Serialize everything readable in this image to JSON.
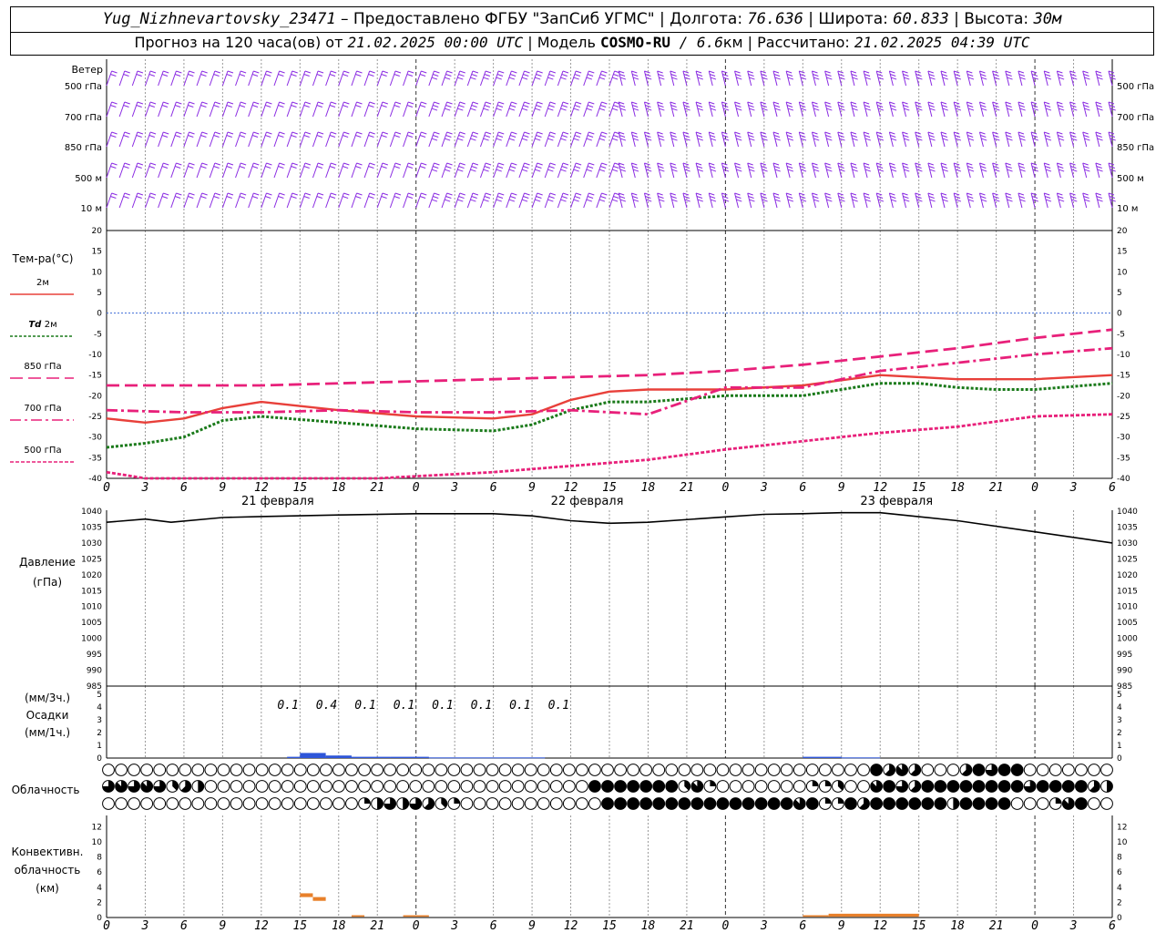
{
  "header": {
    "station": "Yug_Nizhnevartovsky_23471",
    "provider": " – Предоставлено ФГБУ \"ЗапСиб УГМС\" | ",
    "lon_label": "Долгота: ",
    "lon": "76.636",
    "lat_label": " | Широта: ",
    "lat": "60.833",
    "alt_label": " | Высота: ",
    "alt": "30м",
    "forecast_prefix": "Прогноз на 120 часа(ов) от ",
    "forecast_time": "21.02.2025 00:00 UTC",
    "model_label": " | Модель ",
    "model": "COSMO-RU",
    "resolution": " / 6.6",
    "resolution_unit": "км",
    "calc_label": " | Рассчитано: ",
    "calc_time": "21.02.2025 04:39 UTC"
  },
  "wind": {
    "title": "Ветер",
    "levels": [
      "500 гПа",
      "700 гПа",
      "850 гПа",
      "500 м",
      "10 м"
    ],
    "color": "#8a2be2"
  },
  "chart_data": [
    {
      "type": "line",
      "panel": "temperature",
      "ylabel": "Тем-ра(°C)",
      "ylim": [
        -40,
        20
      ],
      "yticks": [
        20,
        15,
        10,
        5,
        0,
        -5,
        -10,
        -15,
        -20,
        -25,
        -30,
        -35,
        -40
      ],
      "x_hours": [
        0,
        6,
        12,
        18,
        24,
        30,
        36,
        42,
        48,
        54,
        60,
        66,
        72,
        78
      ],
      "series": [
        {
          "name": "2м",
          "color": "#e8403a",
          "dash": "solid",
          "x": [
            0,
            3,
            6,
            9,
            12,
            18,
            24,
            30,
            33,
            36,
            39,
            42,
            48,
            54,
            60,
            63,
            66,
            69,
            72,
            78
          ],
          "values": [
            -25.5,
            -26.5,
            -25.5,
            -23,
            -21.5,
            -23.5,
            -25,
            -25.5,
            -24.5,
            -21,
            -19,
            -18.5,
            -18.5,
            -17.5,
            -15,
            -15.5,
            -16,
            -16,
            -16,
            -15
          ]
        },
        {
          "name": "Td 2м",
          "color": "#1a7a1a",
          "dash": "dotted",
          "x": [
            0,
            3,
            6,
            9,
            12,
            18,
            24,
            30,
            33,
            36,
            39,
            42,
            48,
            54,
            60,
            63,
            66,
            69,
            72,
            78
          ],
          "values": [
            -32.5,
            -31.5,
            -30,
            -26,
            -25,
            -26.5,
            -28,
            -28.5,
            -27,
            -23.5,
            -21.5,
            -21.5,
            -20,
            -20,
            -17,
            -17,
            -18,
            -18.5,
            -18.5,
            -17
          ]
        },
        {
          "name": "850 гПа",
          "color": "#e8207a",
          "dash": "longdash",
          "x": [
            0,
            6,
            12,
            18,
            24,
            30,
            36,
            42,
            48,
            54,
            60,
            66,
            72,
            78
          ],
          "values": [
            -17.5,
            -17.5,
            -17.5,
            -17,
            -16.5,
            -16,
            -15.5,
            -15,
            -14,
            -12.5,
            -10.5,
            -8.5,
            -6,
            -4
          ]
        },
        {
          "name": "700 гПа",
          "color": "#e8207a",
          "dash": "dashdot",
          "x": [
            0,
            6,
            12,
            18,
            24,
            30,
            36,
            42,
            48,
            54,
            60,
            66,
            72,
            78
          ],
          "values": [
            -23.5,
            -24,
            -24,
            -23.5,
            -24,
            -24,
            -23.5,
            -24.5,
            -18,
            -18,
            -14,
            -12,
            -10,
            -8.5
          ]
        },
        {
          "name": "500 гПа",
          "color": "#e8207a",
          "dash": "shortdash",
          "x": [
            0,
            3,
            6,
            9,
            12,
            18,
            21,
            24,
            30,
            36,
            42,
            48,
            54,
            60,
            66,
            72,
            78
          ],
          "values": [
            -38.5,
            -40,
            -41,
            -41,
            -41,
            -41,
            -40,
            -39.5,
            -38.5,
            -37,
            -35.5,
            -33,
            -31,
            -29,
            -27.5,
            -25,
            -24.5
          ]
        }
      ]
    },
    {
      "type": "line",
      "panel": "pressure",
      "ylabel": "Давление",
      "ylabel2": "(гПа)",
      "ylim": [
        985,
        1040
      ],
      "yticks": [
        1040,
        1035,
        1030,
        1025,
        1020,
        1015,
        1010,
        1005,
        1000,
        995,
        990,
        985
      ],
      "series": [
        {
          "color": "#000000",
          "dash": "solid",
          "x": [
            0,
            3,
            5,
            9,
            12,
            18,
            24,
            30,
            33,
            36,
            39,
            42,
            48,
            51,
            54,
            57,
            60,
            66,
            72,
            78
          ],
          "values": [
            1036.5,
            1037.5,
            1036.5,
            1038,
            1038.3,
            1038.8,
            1039.2,
            1039.2,
            1038.5,
            1037,
            1036.2,
            1036.5,
            1038.2,
            1039,
            1039.2,
            1039.5,
            1039.5,
            1037,
            1033.5,
            1030
          ]
        }
      ]
    },
    {
      "type": "bar",
      "panel": "precipitation",
      "ylabel1": "(мм/3ч.)",
      "ylabel2": "Осадки",
      "ylabel3": "(мм/1ч.)",
      "ylim": [
        0,
        5
      ],
      "yticks": [
        5,
        4,
        3,
        2,
        1,
        0
      ],
      "bars": [
        {
          "x": 14,
          "w": 1,
          "values": 0.1
        },
        {
          "x": 15,
          "w": 2,
          "values": 0.4
        },
        {
          "x": 17,
          "w": 2,
          "values": 0.2
        },
        {
          "x": 19,
          "w": 3,
          "values": 0.1
        },
        {
          "x": 22,
          "w": 3,
          "values": 0.1
        },
        {
          "x": 25,
          "w": 9,
          "values": 0.05
        },
        {
          "x": 54,
          "w": 3,
          "values": 0.1
        },
        {
          "x": 57,
          "w": 3,
          "values": 0.05
        }
      ],
      "labels": [
        {
          "x": 13.5,
          "text": "0.1"
        },
        {
          "x": 16.5,
          "text": "0.4"
        },
        {
          "x": 19.5,
          "text": "0.1"
        },
        {
          "x": 22.5,
          "text": "0.1"
        },
        {
          "x": 25.5,
          "text": "0.1"
        },
        {
          "x": 28.5,
          "text": "0.1"
        },
        {
          "x": 31.5,
          "text": "0.1"
        },
        {
          "x": 34.5,
          "text": "0.1"
        }
      ],
      "color": "#2e56d9"
    },
    {
      "type": "heatmap",
      "panel": "cloudiness",
      "ylabel": "Облачность",
      "note": "octas of cover per hour for upper, middle and low cloud rows",
      "rows": [
        {
          "segments": [
            [
              0,
              60,
              0
            ],
            [
              60,
              61,
              8
            ],
            [
              61,
              62,
              5
            ],
            [
              62,
              63,
              7
            ],
            [
              63,
              64,
              5
            ],
            [
              64,
              67,
              0
            ],
            [
              67,
              68,
              5
            ],
            [
              68,
              69,
              8
            ],
            [
              69,
              70,
              6
            ],
            [
              70,
              72,
              8
            ],
            [
              72,
              79,
              0
            ]
          ]
        },
        {
          "segments": [
            [
              0,
              1,
              6
            ],
            [
              1,
              2,
              7
            ],
            [
              2,
              3,
              6
            ],
            [
              3,
              4,
              7
            ],
            [
              4,
              5,
              6
            ],
            [
              5,
              6,
              3
            ],
            [
              6,
              7,
              5
            ],
            [
              7,
              8,
              4
            ],
            [
              8,
              38,
              0
            ],
            [
              38,
              45,
              8
            ],
            [
              45,
              46,
              3
            ],
            [
              46,
              47,
              7
            ],
            [
              47,
              48,
              2
            ],
            [
              48,
              55,
              0
            ],
            [
              55,
              57,
              2
            ],
            [
              57,
              58,
              3
            ],
            [
              58,
              60,
              0
            ],
            [
              60,
              61,
              7
            ],
            [
              61,
              62,
              8
            ],
            [
              62,
              63,
              6
            ],
            [
              63,
              64,
              5
            ],
            [
              64,
              72,
              8
            ],
            [
              72,
              73,
              6
            ],
            [
              73,
              74,
              8
            ],
            [
              74,
              77,
              8
            ],
            [
              77,
              78,
              5
            ],
            [
              78,
              79,
              4
            ]
          ]
        },
        {
          "segments": [
            [
              0,
              20,
              0
            ],
            [
              20,
              21,
              2
            ],
            [
              21,
              22,
              4
            ],
            [
              22,
              23,
              6
            ],
            [
              23,
              24,
              4
            ],
            [
              24,
              25,
              6
            ],
            [
              25,
              26,
              5
            ],
            [
              26,
              27,
              3
            ],
            [
              27,
              28,
              2
            ],
            [
              28,
              39,
              0
            ],
            [
              39,
              54,
              8
            ],
            [
              54,
              55,
              7
            ],
            [
              55,
              56,
              8
            ],
            [
              56,
              58,
              2
            ],
            [
              58,
              59,
              8
            ],
            [
              59,
              60,
              5
            ],
            [
              60,
              66,
              8
            ],
            [
              66,
              67,
              4
            ],
            [
              67,
              68,
              8
            ],
            [
              68,
              71,
              8
            ],
            [
              71,
              72,
              0
            ],
            [
              72,
              74,
              0
            ],
            [
              74,
              75,
              2
            ],
            [
              75,
              76,
              7
            ],
            [
              76,
              77,
              8
            ],
            [
              77,
              78,
              0
            ],
            [
              78,
              79,
              0
            ]
          ]
        }
      ]
    },
    {
      "type": "bar",
      "panel": "convective",
      "ylabel1": "Конвективн.",
      "ylabel2": "облачность",
      "ylabel3": "(км)",
      "ylim": [
        0,
        13
      ],
      "yticks": [
        12,
        10,
        8,
        6,
        4,
        2,
        0
      ],
      "bars": [
        {
          "x": 15,
          "w": 1,
          "bottom": 2.7,
          "top": 3.2
        },
        {
          "x": 16,
          "w": 1,
          "bottom": 2.2,
          "top": 2.7
        },
        {
          "x": 19,
          "w": 1,
          "bottom": 0.1,
          "top": 0.3
        },
        {
          "x": 23,
          "w": 2,
          "bottom": 0.1,
          "top": 0.3
        },
        {
          "x": 54,
          "w": 2,
          "bottom": 0.1,
          "top": 0.3
        },
        {
          "x": 56,
          "w": 7,
          "bottom": 0.1,
          "top": 0.5
        }
      ],
      "color": "#e8802a"
    }
  ],
  "axis": {
    "hour_labels": [
      "0",
      "3",
      "6",
      "9",
      "12",
      "15",
      "18",
      "21",
      "0",
      "3",
      "6",
      "9",
      "12",
      "15",
      "18",
      "21",
      "0",
      "3",
      "6",
      "9",
      "12",
      "15",
      "18",
      "21",
      "0",
      "3",
      "6"
    ],
    "days": [
      "21 февраля",
      "22 февраля",
      "23 февраля"
    ]
  },
  "legend": {
    "t2m": "2м",
    "td_prefix": "Td",
    "td_suffix": "2м",
    "p850": "850 гПа",
    "p700": "700 гПа",
    "p500": "500 гПа"
  }
}
